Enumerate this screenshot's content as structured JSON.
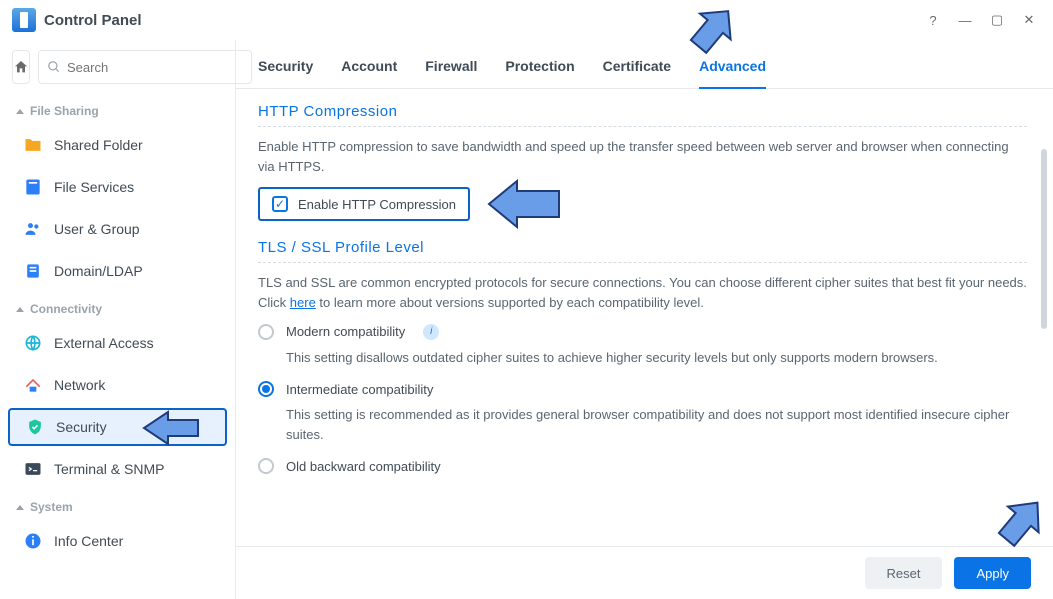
{
  "window": {
    "title": "Control Panel"
  },
  "search": {
    "placeholder": "Search"
  },
  "sidebar": {
    "sections": [
      {
        "label": "File Sharing"
      },
      {
        "label": "Connectivity"
      },
      {
        "label": "System"
      }
    ],
    "items": {
      "sharedFolder": "Shared Folder",
      "fileServices": "File Services",
      "userGroup": "User & Group",
      "domainLdap": "Domain/LDAP",
      "externalAccess": "External Access",
      "network": "Network",
      "security": "Security",
      "terminalSnmp": "Terminal & SNMP",
      "infoCenter": "Info Center"
    }
  },
  "tabs": {
    "security": "Security",
    "account": "Account",
    "firewall": "Firewall",
    "protection": "Protection",
    "certificate": "Certificate",
    "advanced": "Advanced"
  },
  "http": {
    "title": "HTTP Compression",
    "desc": "Enable HTTP compression to save bandwidth and speed up the transfer speed between web server and browser when connecting via HTTPS.",
    "checkbox": "Enable HTTP Compression"
  },
  "tls": {
    "title": "TLS / SSL Profile Level",
    "desc_prefix": "TLS and SSL are common encrypted protocols for secure connections. You can choose different cipher suites that best fit your needs. Click ",
    "desc_link": "here",
    "desc_suffix": " to learn more about versions supported by each compatibility level.",
    "modern": {
      "label": "Modern compatibility",
      "caption": "This setting disallows outdated cipher suites to achieve higher security levels but only supports modern browsers."
    },
    "intermediate": {
      "label": "Intermediate compatibility",
      "caption": "This setting is recommended as it provides general browser compatibility and does not support most identified insecure cipher suites."
    },
    "old": {
      "label": "Old backward compatibility"
    }
  },
  "buttons": {
    "reset": "Reset",
    "apply": "Apply"
  }
}
